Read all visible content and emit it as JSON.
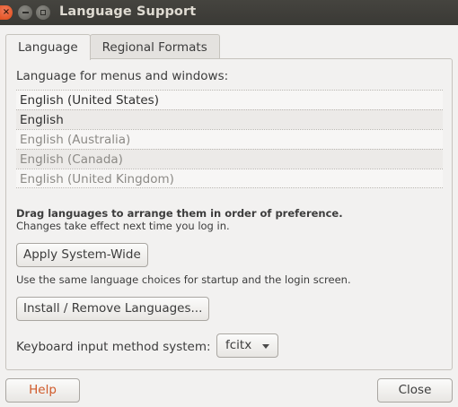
{
  "window": {
    "title": "Language Support",
    "close_glyph": "×",
    "close_icon": "close-icon",
    "minimize_icon": "minimize-icon",
    "maximize_icon": "maximize-icon"
  },
  "tabs": [
    {
      "label": "Language",
      "active": true
    },
    {
      "label": "Regional Formats",
      "active": false
    }
  ],
  "language_tab": {
    "heading": "Language for menus and windows:",
    "languages": [
      {
        "label": "English (United States)",
        "active": true
      },
      {
        "label": "English",
        "active": true
      },
      {
        "label": "English (Australia)",
        "active": false
      },
      {
        "label": "English (Canada)",
        "active": false
      },
      {
        "label": "English (United Kingdom)",
        "active": false
      }
    ],
    "drag_hint": "Drag languages to arrange them in order of preference.",
    "change_hint": "Changes take effect next time you log in.",
    "apply_button": "Apply System-Wide",
    "apply_description": "Use the same language choices for startup and the login screen.",
    "install_button": "Install / Remove Languages...",
    "keyboard_label": "Keyboard input method system:",
    "keyboard_value": "fcitx"
  },
  "footer": {
    "help_button": "Help",
    "close_button": "Close"
  },
  "colors": {
    "titlebar": "#3c3b37",
    "close_button": "#df4a16",
    "help_text": "#d05a2a",
    "window_bg": "#f2f1f0"
  }
}
